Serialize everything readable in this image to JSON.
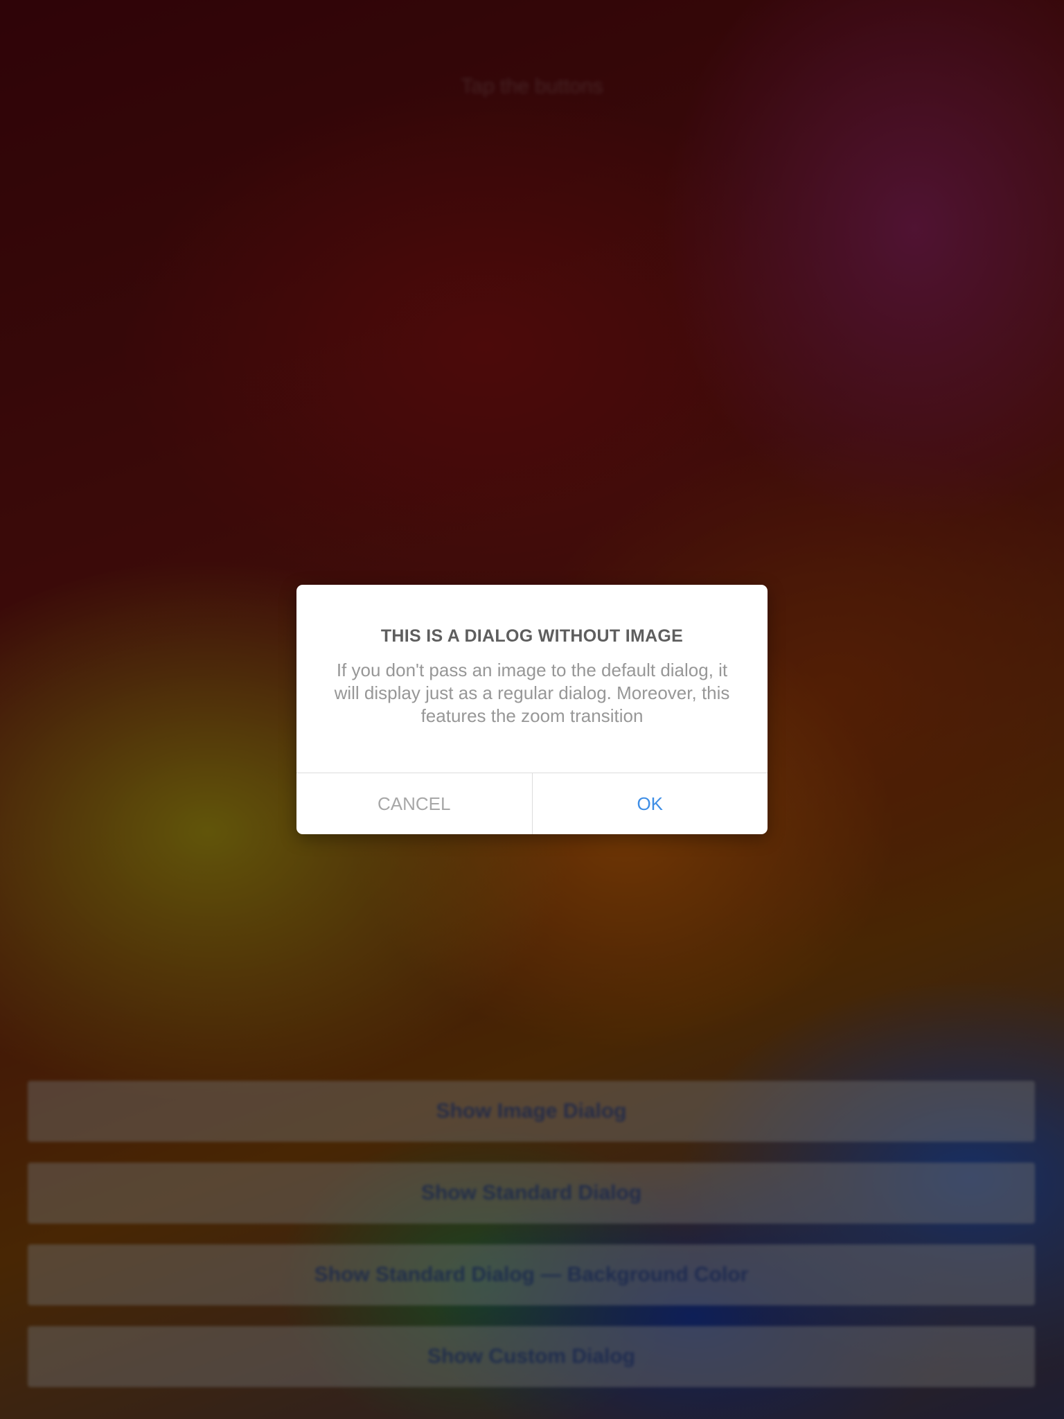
{
  "background": {
    "top_hint": "Tap the buttons",
    "buttons": [
      {
        "label": "Show Image Dialog"
      },
      {
        "label": "Show Standard Dialog"
      },
      {
        "label": "Show Standard Dialog — Background Color"
      },
      {
        "label": "Show Custom Dialog"
      }
    ]
  },
  "dialog": {
    "title": "THIS IS A DIALOG WITHOUT IMAGE",
    "message": "If you don't pass an image to the default dialog, it will display just as a regular dialog. Moreover, this features the zoom transition",
    "cancel_label": "CANCEL",
    "ok_label": "OK"
  },
  "colors": {
    "ok_accent": "#3e8ee6",
    "cancel_text": "#a7a7a7",
    "title_text": "#5e5e5e",
    "message_text": "#979797"
  }
}
